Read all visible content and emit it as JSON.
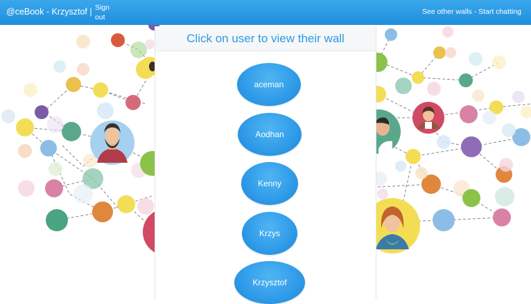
{
  "navbar": {
    "brand": "@ceBook - Krzysztof |",
    "sign_out": "Sign out",
    "see_other_walls": "See other walls",
    "separator": " - ",
    "start_chatting": "Start chatting"
  },
  "panel": {
    "title": "Click on user to view their wall"
  },
  "users": [
    "aceman",
    "Aodhan",
    "Kenny",
    "Krzys",
    "Krzysztof"
  ],
  "colors": {
    "navbar": "#2398e4",
    "accent": "#2e9ae4",
    "user_button": "#2f9ae8"
  }
}
